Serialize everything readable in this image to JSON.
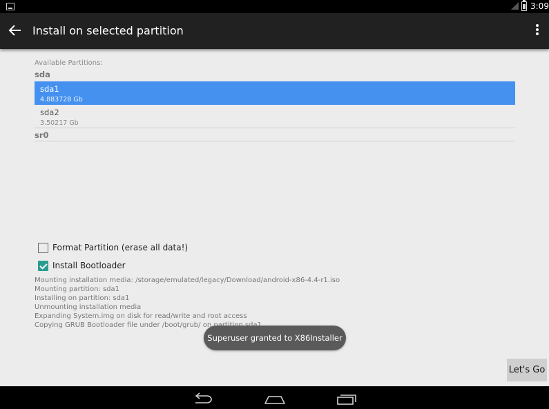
{
  "status_bar": {
    "time": "3:09"
  },
  "app_bar": {
    "title": "Install on selected partition"
  },
  "partitions": {
    "label": "Available Partitions:",
    "disks": [
      {
        "name": "sda",
        "parts": [
          {
            "name": "sda1",
            "size": "4.883728 Gb",
            "selected": true
          },
          {
            "name": "sda2",
            "size": "3.50217 Gb",
            "selected": false
          }
        ]
      },
      {
        "name": "sr0",
        "parts": []
      }
    ]
  },
  "options": {
    "format_label": "Format Partition (erase all data!)",
    "format_checked": false,
    "bootloader_label": "Install Bootloader",
    "bootloader_checked": true
  },
  "log": [
    "Mounting installation media: /storage/emulated/legacy/Download/android-x86-4.4-r1.iso",
    "Mounting partition: sda1",
    "Installing on partition: sda1",
    "Unmounting installation media",
    "Expanding System.img on disk for read/write and root access",
    "Copying GRUB Bootloader file under /boot/grub/ on partition sda1"
  ],
  "toast": "Superuser granted to X86Installer",
  "button": {
    "label": "Let's Go"
  },
  "colors": {
    "selected": "#4591f0",
    "checkbox": "#2b9b8f",
    "app_bar": "#212121"
  }
}
